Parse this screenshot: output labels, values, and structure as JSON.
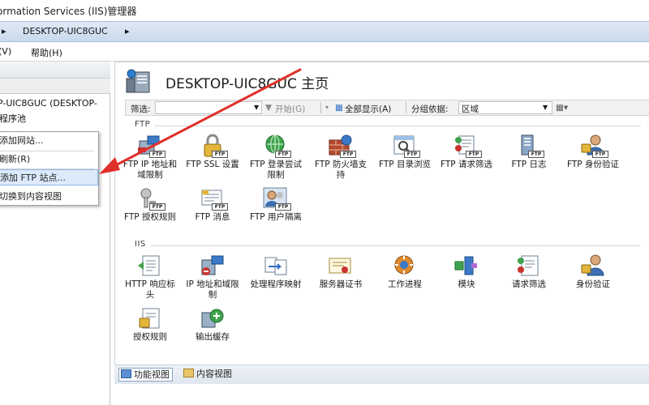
{
  "window": {
    "title": "ormation Services (IIS)管理器"
  },
  "address": {
    "separator": "▸",
    "path": "DESKTOP-UIC8GUC",
    "trail": "▸"
  },
  "menu": {
    "view": "(V)",
    "help": "帮助(H)"
  },
  "tree": {
    "server": "P-UIC8GUC (DESKTOP-",
    "apppools": "程序池"
  },
  "context_menu": {
    "add_site": "添加网站...",
    "refresh": "刷新(R)",
    "add_ftp_site": "添加 FTP 站点...",
    "switch_view": "切换到内容视图"
  },
  "page": {
    "title": "DESKTOP-UIC8GUC 主页"
  },
  "filter": {
    "label": "筛选:",
    "start": "开始(G)",
    "show_all": "全部显示(A)",
    "group_by": "分组依据:",
    "group_value": "区域"
  },
  "groups": {
    "ftp": "FTP",
    "iis": "IIS"
  },
  "ftp_features": [
    {
      "label": "FTP IP 地址和域限制",
      "icon": "ftp-ip-restrictions-icon"
    },
    {
      "label": "FTP SSL 设置",
      "icon": "ftp-ssl-lock-icon"
    },
    {
      "label": "FTP 登录尝试限制",
      "icon": "ftp-logon-globe-icon"
    },
    {
      "label": "FTP 防火墙支持",
      "icon": "ftp-firewall-icon"
    },
    {
      "label": "FTP 目录浏览",
      "icon": "ftp-directory-browse-icon"
    },
    {
      "label": "FTP 请求筛选",
      "icon": "ftp-request-filter-icon"
    },
    {
      "label": "FTP 日志",
      "icon": "ftp-log-icon"
    },
    {
      "label": "FTP 身份验证",
      "icon": "ftp-authentication-icon"
    },
    {
      "label": "FTP 授权规则",
      "icon": "ftp-authorization-icon"
    },
    {
      "label": "FTP 消息",
      "icon": "ftp-messages-icon"
    },
    {
      "label": "FTP 用户隔离",
      "icon": "ftp-user-isolation-icon"
    }
  ],
  "iis_features": [
    {
      "label": "HTTP 响应标头",
      "icon": "http-headers-icon"
    },
    {
      "label": "IP 地址和域限制",
      "icon": "ip-restrictions-icon"
    },
    {
      "label": "处理程序映射",
      "icon": "handler-mappings-icon"
    },
    {
      "label": "服务器证书",
      "icon": "server-certificates-icon"
    },
    {
      "label": "工作进程",
      "icon": "worker-processes-icon"
    },
    {
      "label": "模块",
      "icon": "modules-icon"
    },
    {
      "label": "请求筛选",
      "icon": "request-filtering-icon"
    },
    {
      "label": "身份验证",
      "icon": "authentication-icon"
    },
    {
      "label": "授权规则",
      "icon": "authorization-rules-icon"
    },
    {
      "label": "输出缓存",
      "icon": "output-caching-icon"
    }
  ],
  "bottom": {
    "features_view": "功能视图",
    "content_view": "内容视图"
  },
  "colors": {
    "annotation_arrow": "#e0302a",
    "selection": "#dceafc",
    "accent": "#2b6cc4"
  }
}
